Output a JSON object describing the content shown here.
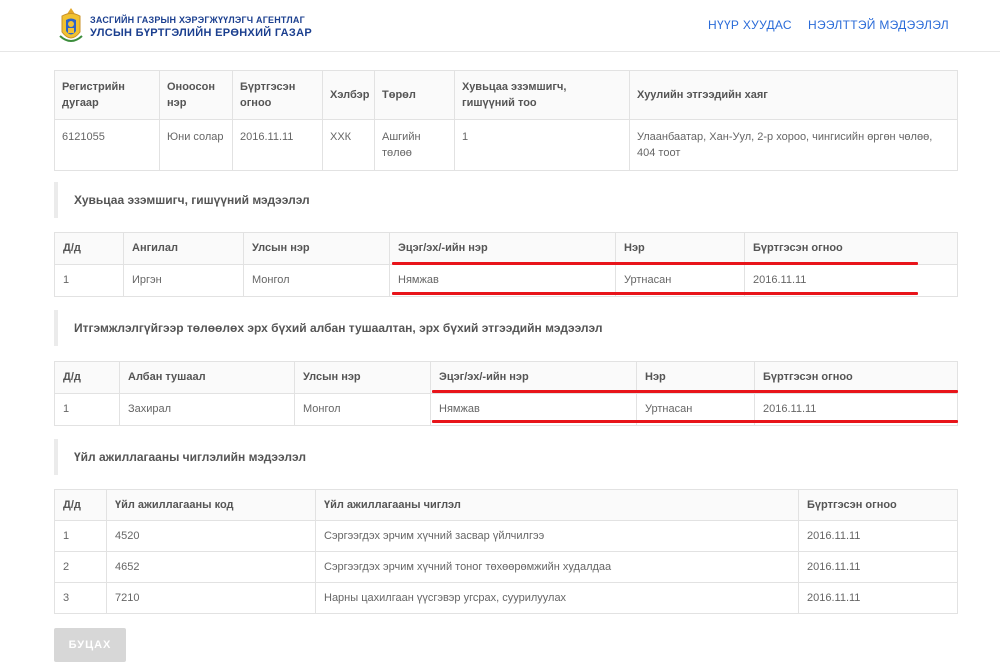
{
  "header": {
    "agency_line1": "ЗАСГИЙН ГАЗРЫН ХЭРЭГЖҮҮЛЭГЧ АГЕНТЛАГ",
    "agency_line2": "УЛСЫН БҮРТГЭЛИЙН ЕРӨНХИЙ ГАЗАР",
    "nav": [
      {
        "label": "НҮҮР ХУУДАС"
      },
      {
        "label": "НЭЭЛТТЭЙ МЭДЭЭЛЭЛ"
      }
    ]
  },
  "company": {
    "headers": [
      "Регистрийн дугаар",
      "Оноосон нэр",
      "Бүртгэсэн огноо",
      "Хэлбэр",
      "Төрөл",
      "Хувьцаа эзэмшигч, гишүүний тоо",
      "Хуулийн этгээдийн хаяг"
    ],
    "row": [
      "6121055",
      "Юни солар",
      "2016.11.11",
      "ХХК",
      "Ашгийн төлөө",
      "1",
      "Улаанбаатар, Хан-Уул, 2-р хороо, чингисийн өргөн чөлөө, 404 тоот"
    ]
  },
  "shareholders": {
    "title": "Хувьцаа эзэмшигч, гишүүний мэдээлэл",
    "headers": [
      "Д/д",
      "Ангилал",
      "Улсын нэр",
      "Эцэг/эх/-ийн нэр",
      "Нэр",
      "Бүртгэсэн огноо"
    ],
    "row": [
      "1",
      "Иргэн",
      "Монгол",
      "Нямжав",
      "Уртнасан",
      "2016.11.11"
    ]
  },
  "representatives": {
    "title": "Итгэмжлэлгүйгээр төлөөлөх эрх бүхий албан тушаалтан, эрх бүхий этгээдийн мэдээлэл",
    "headers": [
      "Д/д",
      "Албан тушаал",
      "Улсын нэр",
      "Эцэг/эх/-ийн нэр",
      "Нэр",
      "Бүртгэсэн огноо"
    ],
    "row": [
      "1",
      "Захирал",
      "Монгол",
      "Нямжав",
      "Уртнасан",
      "2016.11.11"
    ]
  },
  "activities": {
    "title": "Үйл ажиллагааны чиглэлийн мэдээлэл",
    "headers": [
      "Д/д",
      "Үйл ажиллагааны код",
      "Үйл ажиллагааны чиглэл",
      "Бүртгэсэн огноо"
    ],
    "rows": [
      [
        "1",
        "4520",
        "Сэргээгдэх эрчим хүчний засвар үйлчилгээ",
        "2016.11.11"
      ],
      [
        "2",
        "4652",
        "Сэргээгдэх эрчим хүчний тоног төхөөрөмжийн худалдаа",
        "2016.11.11"
      ],
      [
        "3",
        "7210",
        "Нарны цахилгаан үүсгэвэр угсрах, суурилуулах",
        "2016.11.11"
      ]
    ]
  },
  "back_button": {
    "label": "БУЦАХ"
  },
  "colors": {
    "brand": "#1b3f8f",
    "link": "#2a6bd8",
    "highlight": "#e8141a"
  }
}
